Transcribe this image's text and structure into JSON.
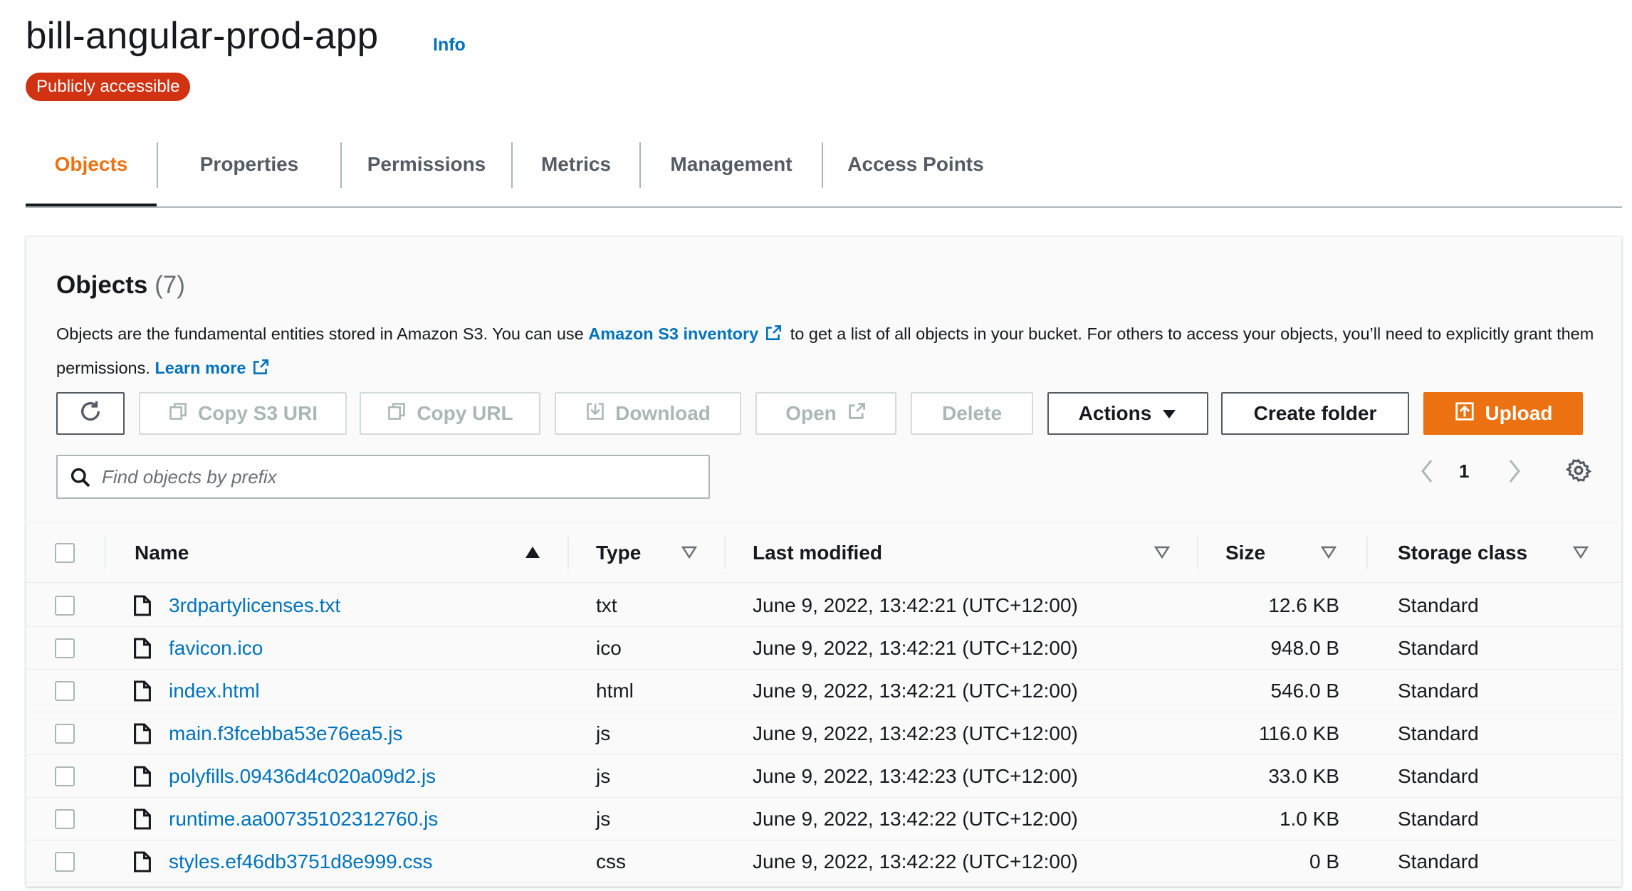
{
  "header": {
    "bucket_name": "bill-angular-prod-app",
    "info_label": "Info",
    "badge": "Publicly accessible"
  },
  "tabs": [
    "Objects",
    "Properties",
    "Permissions",
    "Metrics",
    "Management",
    "Access Points"
  ],
  "active_tab": "Objects",
  "objects_panel": {
    "title": "Objects",
    "count": "(7)",
    "description_1": "Objects are the fundamental entities stored in Amazon S3. You can use",
    "inventory_link": "Amazon S3 inventory",
    "description_2": "to get a list of all objects in your bucket. For others to access your objects, you’ll need to explicitly grant them permissions.",
    "learn_more": "Learn more"
  },
  "toolbar": {
    "copy_s3_uri": "Copy S3 URI",
    "copy_url": "Copy URL",
    "download": "Download",
    "open": "Open",
    "delete": "Delete",
    "actions": "Actions",
    "create_folder": "Create folder",
    "upload": "Upload"
  },
  "search": {
    "placeholder": "Find objects by prefix",
    "value": ""
  },
  "pagination": {
    "current_page": "1"
  },
  "table": {
    "columns": [
      "Name",
      "Type",
      "Last modified",
      "Size",
      "Storage class"
    ],
    "rows": [
      {
        "name": "3rdpartylicenses.txt",
        "type": "txt",
        "last_modified": "June 9, 2022, 13:42:21 (UTC+12:00)",
        "size": "12.6 KB",
        "storage_class": "Standard"
      },
      {
        "name": "favicon.ico",
        "type": "ico",
        "last_modified": "June 9, 2022, 13:42:21 (UTC+12:00)",
        "size": "948.0 B",
        "storage_class": "Standard"
      },
      {
        "name": "index.html",
        "type": "html",
        "last_modified": "June 9, 2022, 13:42:21 (UTC+12:00)",
        "size": "546.0 B",
        "storage_class": "Standard"
      },
      {
        "name": "main.f3fcebba53e76ea5.js",
        "type": "js",
        "last_modified": "June 9, 2022, 13:42:23 (UTC+12:00)",
        "size": "116.0 KB",
        "storage_class": "Standard"
      },
      {
        "name": "polyfills.09436d4c020a09d2.js",
        "type": "js",
        "last_modified": "June 9, 2022, 13:42:23 (UTC+12:00)",
        "size": "33.0 KB",
        "storage_class": "Standard"
      },
      {
        "name": "runtime.aa00735102312760.js",
        "type": "js",
        "last_modified": "June 9, 2022, 13:42:22 (UTC+12:00)",
        "size": "1.0 KB",
        "storage_class": "Standard"
      },
      {
        "name": "styles.ef46db3751d8e999.css",
        "type": "css",
        "last_modified": "June 9, 2022, 13:42:22 (UTC+12:00)",
        "size": "0 B",
        "storage_class": "Standard"
      }
    ]
  },
  "colors": {
    "accent_orange": "#ec7211",
    "link_blue": "#0073bb",
    "badge_red": "#d13212",
    "text_dark": "#16191f",
    "disabled_gray": "#aab7b8"
  }
}
